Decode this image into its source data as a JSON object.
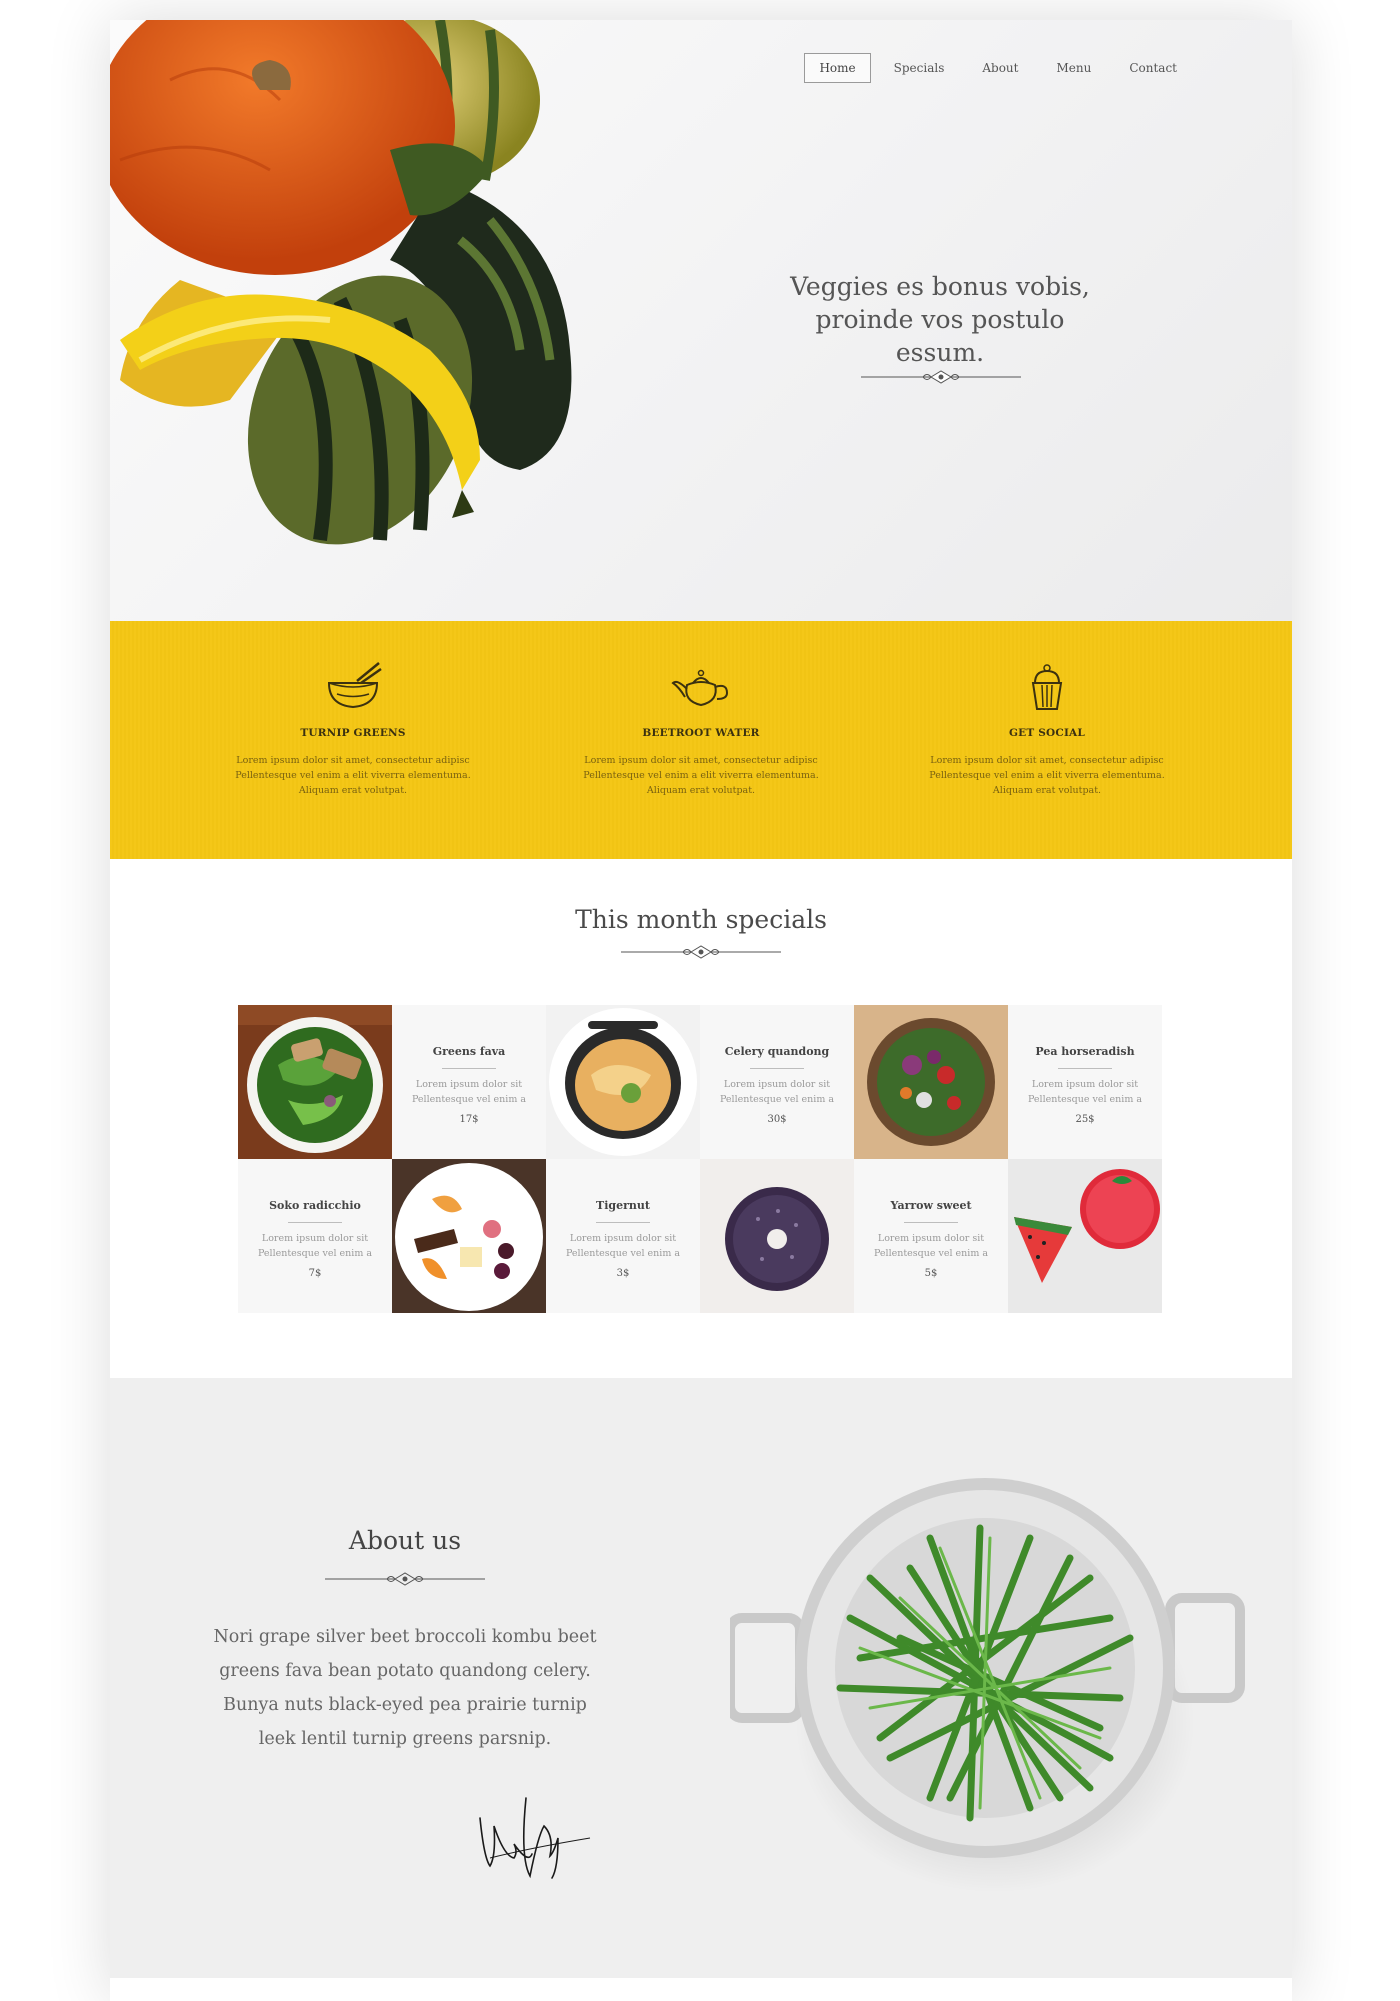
{
  "nav": {
    "items": [
      {
        "label": "Home",
        "active": true
      },
      {
        "label": "Specials",
        "active": false
      },
      {
        "label": "About",
        "active": false
      },
      {
        "label": "Menu",
        "active": false
      },
      {
        "label": "Contact",
        "active": false
      }
    ]
  },
  "hero": {
    "tagline_line1": "Veggies es bonus vobis,",
    "tagline_line2": "proinde vos postulo essum."
  },
  "features": [
    {
      "icon": "rice-bowl-chopsticks-icon",
      "title": "TURNIP GREENS",
      "text": "Lorem ipsum dolor sit amet, consectetur adipisc Pellentesque vel enim a elit viverra elementuma. Aliquam erat volutpat."
    },
    {
      "icon": "teapot-icon",
      "title": "BEETROOT WATER",
      "text": "Lorem ipsum dolor sit amet, consectetur adipisc Pellentesque vel enim a elit viverra elementuma. Aliquam erat volutpat."
    },
    {
      "icon": "cupcake-icon",
      "title": "GET SOCIAL",
      "text": "Lorem ipsum dolor sit amet, consectetur adipisc Pellentesque vel enim a elit viverra elementuma. Aliquam erat volutpat."
    }
  ],
  "specials": {
    "title": "This month specials",
    "items": [
      {
        "name": "Greens fava",
        "desc": "Lorem ipsum dolor sit Pellentesque vel enim a",
        "price": "17$"
      },
      {
        "name": "Celery quandong",
        "desc": "Lorem ipsum dolor sit Pellentesque vel enim a",
        "price": "30$"
      },
      {
        "name": "Pea horseradish",
        "desc": "Lorem ipsum dolor sit Pellentesque vel enim a",
        "price": "25$"
      },
      {
        "name": "Soko radicchio",
        "desc": "Lorem ipsum dolor sit Pellentesque vel enim a",
        "price": "7$"
      },
      {
        "name": "Tigernut",
        "desc": "Lorem ipsum dolor sit Pellentesque vel enim a",
        "price": "3$"
      },
      {
        "name": "Yarrow sweet",
        "desc": "Lorem ipsum dolor sit Pellentesque vel enim a",
        "price": "5$"
      }
    ]
  },
  "about": {
    "title": "About us",
    "text": "Nori grape silver beet broccoli kombu beet greens fava bean potato quandong celery. Bunya nuts black-eyed pea prairie turnip leek lentil turnip greens parsnip."
  },
  "colors": {
    "accent_yellow": "#f4c718",
    "text_dark": "#444444",
    "about_bg": "#efefef"
  }
}
